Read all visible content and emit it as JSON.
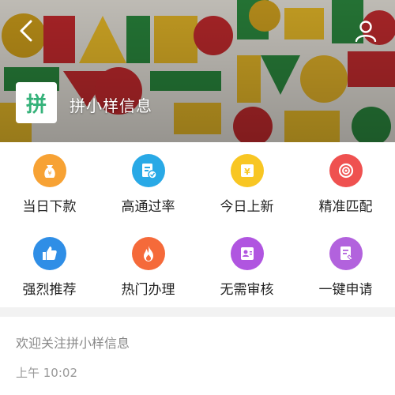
{
  "header": {
    "account_name": "拼小样信息",
    "logo_text": "拼",
    "back_icon": "chevron-left-icon",
    "profile_icon": "user-icon"
  },
  "grid": {
    "items": [
      {
        "label": "当日下款",
        "icon": "money-bag-icon",
        "color": "#f7a234"
      },
      {
        "label": "高通过率",
        "icon": "approved-doc-icon",
        "color": "#29a9e6"
      },
      {
        "label": "今日上新",
        "icon": "new-yen-icon",
        "color": "#f8c623"
      },
      {
        "label": "精准匹配",
        "icon": "target-icon",
        "color": "#ef5150"
      },
      {
        "label": "强烈推荐",
        "icon": "thumbs-up-icon",
        "color": "#2f8ee6"
      },
      {
        "label": "热门办理",
        "icon": "flame-icon",
        "color": "#f56a3a"
      },
      {
        "label": "无需审核",
        "icon": "user-card-icon",
        "color": "#b055e0"
      },
      {
        "label": "一键申请",
        "icon": "apply-doc-icon",
        "color": "#b262dd"
      }
    ]
  },
  "message": {
    "text": "欢迎关注拼小样信息",
    "time": "上午 10:02"
  }
}
